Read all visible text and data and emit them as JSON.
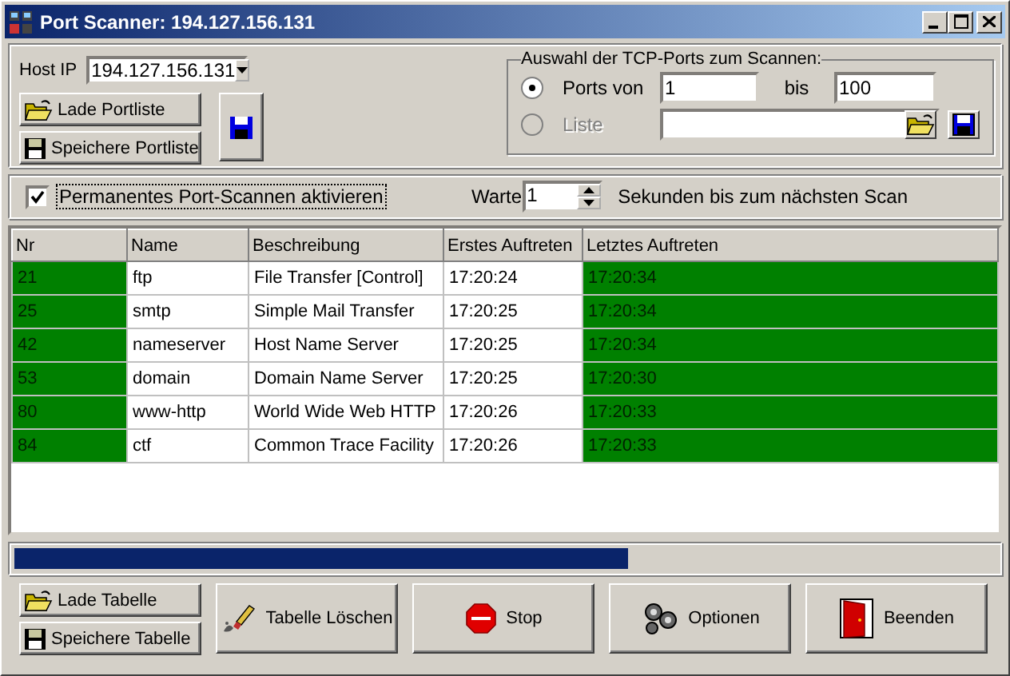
{
  "window": {
    "title": "Port Scanner: 194.127.156.131"
  },
  "host": {
    "label": "Host IP",
    "value": "194.127.156.131"
  },
  "portlist_buttons": [
    {
      "label": "Lade Portliste"
    },
    {
      "label": "Speichere Portliste"
    }
  ],
  "port_selection": {
    "title": "Auswahl der TCP-Ports zum Scannen:",
    "options": [
      {
        "kind": "range",
        "label": "Ports von",
        "selected": true,
        "disabled": false,
        "from": "1",
        "to_label": "bis",
        "to": "100"
      },
      {
        "kind": "list",
        "label": "Liste",
        "selected": false,
        "disabled": true
      }
    ]
  },
  "permanent_scan": {
    "label": "Permanentes Port-Scannen aktivieren",
    "checked": true,
    "focused": true
  },
  "wait": {
    "label": "Warte",
    "value": "1",
    "suffix": "Sekunden bis zum nächsten Scan"
  },
  "table": {
    "columns": [
      "Nr",
      "Name",
      "Beschreibung",
      "Erstes Auftreten",
      "Letztes Auftreten"
    ],
    "rows": [
      {
        "cells": [
          "21",
          "ftp",
          "File Transfer [Control]",
          "17:20:24",
          "17:20:34"
        ],
        "open": true
      },
      {
        "cells": [
          "25",
          "smtp",
          "Simple Mail Transfer",
          "17:20:25",
          "17:20:34"
        ],
        "open": true
      },
      {
        "cells": [
          "42",
          "nameserver",
          "Host Name Server",
          "17:20:25",
          "17:20:34"
        ],
        "open": true
      },
      {
        "cells": [
          "53",
          "domain",
          "Domain Name Server",
          "17:20:25",
          "17:20:30"
        ],
        "open": true
      },
      {
        "cells": [
          "80",
          "www-http",
          "World Wide Web HTTP",
          "17:20:26",
          "17:20:33"
        ],
        "open": true
      },
      {
        "cells": [
          "84",
          "ctf",
          "Common Trace Facility",
          "17:20:26",
          "17:20:33"
        ],
        "open": true
      }
    ]
  },
  "progress": {
    "level": 0.625
  },
  "table_buttons": [
    {
      "label": "Lade Tabelle"
    },
    {
      "label": "Speichere Tabelle"
    }
  ],
  "actions": [
    {
      "label": "Tabelle Löschen"
    },
    {
      "label": "Stop"
    },
    {
      "label": "Optionen"
    },
    {
      "label": "Beenden"
    }
  ]
}
